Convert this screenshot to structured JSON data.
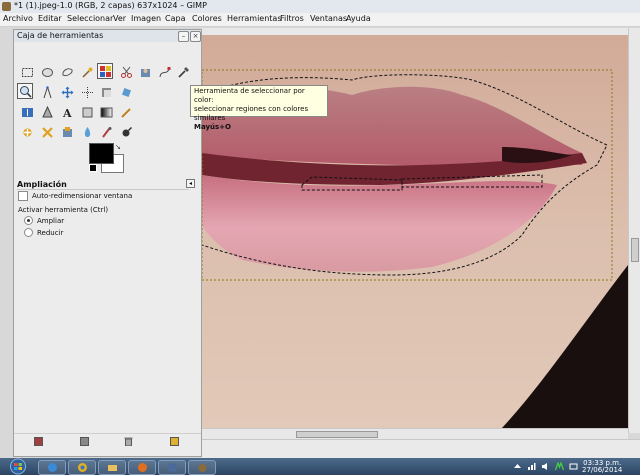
{
  "window": {
    "title": "*1 (1).jpeg-1.0 (RGB, 2 capas) 637x1024 – GIMP"
  },
  "menubar": {
    "items": [
      "Archivo",
      "Editar",
      "Seleccionar",
      "Ver",
      "Imagen",
      "Capa",
      "Colores",
      "Herramientas",
      "Filtros",
      "Ventanas",
      "Ayuda"
    ]
  },
  "toolbox": {
    "title": "Caja de herramientas",
    "rows": [
      [
        "rect-select-icon",
        "ellipse-select-icon",
        "free-select-icon",
        "fuzzy-select-icon",
        "select-by-color-icon",
        "scissors-icon",
        "foreground-select-icon",
        "paths-icon",
        "color-picker-icon"
      ],
      [
        "zoom-icon",
        "measure-icon",
        "move-icon",
        "align-icon",
        "crop-icon",
        "rotate-icon",
        "scale-icon",
        "shear-icon",
        "perspective-icon"
      ],
      [
        "flip-icon",
        "cage-icon",
        "text-icon",
        "bucket-fill-icon",
        "blend-icon",
        "pencil-icon",
        "paintbrush-icon",
        "eraser-icon",
        "airbrush-icon"
      ],
      [
        "heal-icon",
        "clone-icon",
        "perspective-clone-icon",
        "blur-icon",
        "smudge-icon",
        "dodge-burn-icon"
      ]
    ],
    "active_tool": "zoom-icon",
    "hovered_tool": "select-by-color-icon",
    "foreground_color": "#000000",
    "background_color": "#ffffff",
    "options": {
      "header": "Ampliación",
      "auto_resize_label": "Auto-redimensionar ventana",
      "auto_resize_checked": false,
      "activate_label": "Activar herramienta  (Ctrl)",
      "zoom_in_label": "Ampliar",
      "zoom_out_label": "Reducir",
      "selected": "Ampliar"
    }
  },
  "tooltip": {
    "line1": "Herramienta de seleccionar por color:",
    "line2": "seleccionar regiones con colores similares",
    "shortcut": "Mayús+O"
  },
  "taskbar": {
    "time": "03:33 p.m.",
    "date": "27/06/2014"
  },
  "colors": {
    "lip": "#c46f7e",
    "skin": "#dcbfae",
    "shadow": "#1a0f0f"
  }
}
